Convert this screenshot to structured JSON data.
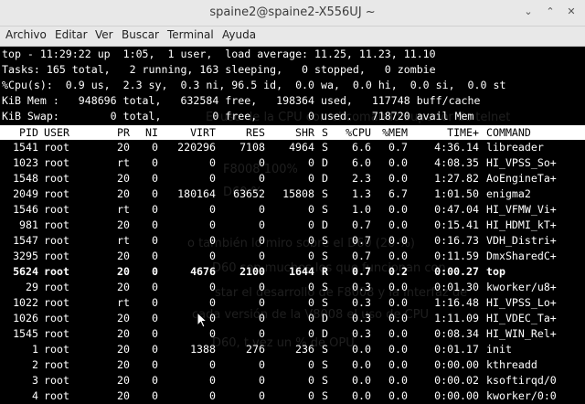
{
  "window": {
    "title": "spaine2@spaine2-X556UJ ~"
  },
  "menu": [
    "Archivo",
    "Editar",
    "Ver",
    "Buscar",
    "Terminal",
    "Ayuda"
  ],
  "summary": [
    "top - 11:29:22 up  1:05,  1 user,  load average: 11.25, 11.23, 11.10",
    "Tasks: 165 total,   2 running, 163 sleeping,   0 stopped,   0 zombie",
    "%Cpu(s):  0.9 us,  2.3 sy,  0.3 ni, 96.5 id,  0.0 wa,  0.0 hi,  0.0 si,  0.0 st",
    "KiB Mem :   948696 total,   632584 free,   198364 used,   117748 buff/cache",
    "KiB Swap:        0 total,        0 free,        0 used.   718720 avail Mem"
  ],
  "columns": [
    "PID",
    "USER",
    "PR",
    "NI",
    "VIRT",
    "RES",
    "SHR",
    "S",
    "%CPU",
    "%MEM",
    "TIME+",
    "COMMAND"
  ],
  "processes": [
    [
      "1541",
      "root",
      "20",
      "0",
      "220296",
      "7108",
      "4964",
      "S",
      "6.6",
      "0.7",
      "4:36.14",
      "libreader"
    ],
    [
      "1023",
      "root",
      "rt",
      "0",
      "0",
      "0",
      "0",
      "D",
      "6.0",
      "0.0",
      "4:08.35",
      "HI_VPSS_So+"
    ],
    [
      "1548",
      "root",
      "20",
      "0",
      "0",
      "0",
      "0",
      "D",
      "2.3",
      "0.0",
      "1:27.82",
      "AoEngineTa+"
    ],
    [
      "2049",
      "root",
      "20",
      "0",
      "180164",
      "63652",
      "15808",
      "S",
      "1.3",
      "6.7",
      "1:01.50",
      "enigma2"
    ],
    [
      "1546",
      "root",
      "rt",
      "0",
      "0",
      "0",
      "0",
      "S",
      "1.0",
      "0.0",
      "0:47.04",
      "HI_VFMW_Vi+"
    ],
    [
      "981",
      "root",
      "20",
      "0",
      "0",
      "0",
      "0",
      "D",
      "0.7",
      "0.0",
      "0:15.41",
      "HI_HDMI_kT+"
    ],
    [
      "1547",
      "root",
      "rt",
      "0",
      "0",
      "0",
      "0",
      "S",
      "0.7",
      "0.0",
      "0:16.73",
      "VDH_Distri+"
    ],
    [
      "3295",
      "root",
      "20",
      "0",
      "0",
      "0",
      "0",
      "S",
      "0.7",
      "0.0",
      "0:11.59",
      "DmxSharedC+"
    ],
    [
      "5624",
      "root",
      "20",
      "0",
      "4676",
      "2100",
      "1644",
      "R",
      "0.7",
      "0.2",
      "0:00.27",
      "top"
    ],
    [
      "29",
      "root",
      "20",
      "0",
      "0",
      "0",
      "0",
      "S",
      "0.3",
      "0.0",
      "0:01.30",
      "kworker/u8+"
    ],
    [
      "1022",
      "root",
      "rt",
      "0",
      "0",
      "0",
      "0",
      "S",
      "0.3",
      "0.0",
      "1:16.48",
      "HI_VPSS_Lo+"
    ],
    [
      "1026",
      "root",
      "20",
      "0",
      "0",
      "0",
      "0",
      "D",
      "0.3",
      "0.0",
      "1:11.09",
      "HI_VDEC_Ta+"
    ],
    [
      "1545",
      "root",
      "20",
      "0",
      "0",
      "0",
      "0",
      "D",
      "0.3",
      "0.0",
      "0:08.34",
      "HI_WIN_Rel+"
    ],
    [
      "1",
      "root",
      "20",
      "0",
      "1388",
      "276",
      "236",
      "S",
      "0.0",
      "0.0",
      "0:01.17",
      "init"
    ],
    [
      "2",
      "root",
      "20",
      "0",
      "0",
      "0",
      "0",
      "S",
      "0.0",
      "0.0",
      "0:00.00",
      "kthreadd"
    ],
    [
      "3",
      "root",
      "20",
      "0",
      "0",
      "0",
      "0",
      "S",
      "0.0",
      "0.0",
      "0:00.02",
      "ksoftirqd/0"
    ],
    [
      "4",
      "root",
      "20",
      "0",
      "0",
      "0",
      "0",
      "S",
      "0.0",
      "0.0",
      "0:00.00",
      "kworker/0:0"
    ]
  ],
  "bold_row": 8,
  "background_text": [
    "El uso de la CPU con el comando  superior de telnet",
    "F8008  100%",
    "D60  %",
    "o también lo miro sobre el D60 (20 %)",
    "D60 son muchos los que funcionan con",
    "star el desarrollo de F8008 y la interfaz de",
    "cada versión de la V8008  el uso de CPU",
    "D60, t  vez un   %  de  OPU"
  ],
  "colors": {
    "terminal_bg": "#000000",
    "terminal_fg": "#ffffff",
    "header_bg": "#ffffff",
    "chrome": "#e8e8e8"
  }
}
